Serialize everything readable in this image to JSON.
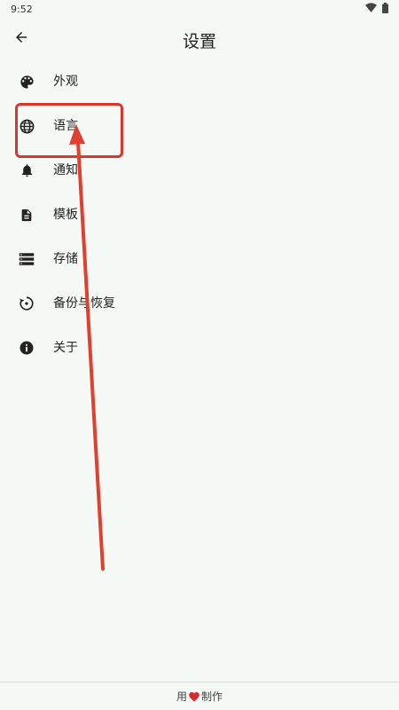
{
  "status_bar": {
    "time": "9:52",
    "wifi_icon": "wifi-icon",
    "battery_icon": "battery-icon"
  },
  "app_bar": {
    "title": "设置",
    "back_icon": "arrow-back-icon"
  },
  "settings": {
    "items": [
      {
        "label": "外观",
        "icon": "palette-icon"
      },
      {
        "label": "语言",
        "icon": "globe-icon"
      },
      {
        "label": "通知",
        "icon": "bell-icon"
      },
      {
        "label": "模板",
        "icon": "document-icon"
      },
      {
        "label": "存储",
        "icon": "storage-icon"
      },
      {
        "label": "备份与恢复",
        "icon": "restore-icon"
      },
      {
        "label": "关于",
        "icon": "info-icon"
      }
    ]
  },
  "annotation": {
    "highlight_color": "#d7382b",
    "target": "语言"
  },
  "footer": {
    "text_before": "用",
    "heart_icon": "heart-icon",
    "text_after": "制作",
    "heart_color": "#d32f2f"
  }
}
